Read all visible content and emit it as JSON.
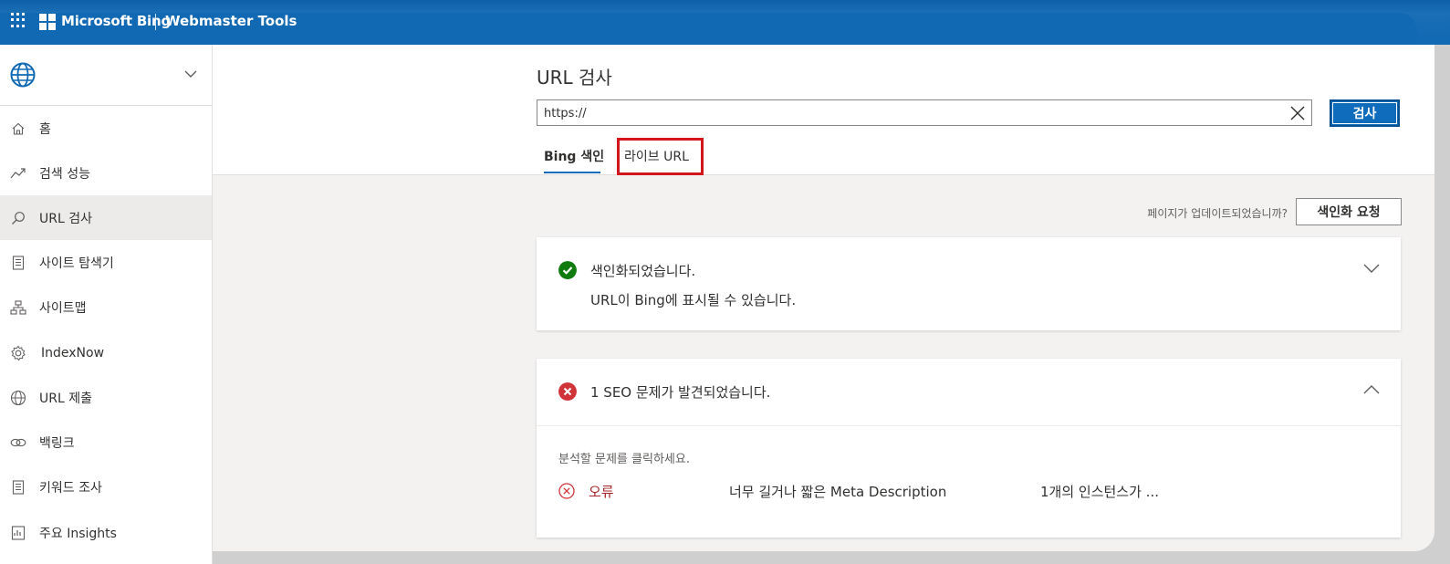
{
  "header": {
    "brand": "Microsoft Bing",
    "product": "Webmaster Tools"
  },
  "sidebar": {
    "items": [
      {
        "label": "홈",
        "icon": "home-icon"
      },
      {
        "label": "검색 성능",
        "icon": "trend-icon"
      },
      {
        "label": "URL 검사",
        "icon": "search-icon",
        "active": true
      },
      {
        "label": "사이트 탐색기",
        "icon": "document-icon"
      },
      {
        "label": "사이트맵",
        "icon": "sitemap-icon"
      },
      {
        "label": "IndexNow",
        "icon": "gear-icon"
      },
      {
        "label": "URL 제출",
        "icon": "globe-icon"
      },
      {
        "label": "백링크",
        "icon": "link-icon"
      },
      {
        "label": "키워드 조사",
        "icon": "document-icon"
      },
      {
        "label": "주요 Insights",
        "icon": "insights-icon"
      }
    ]
  },
  "main": {
    "title": "URL 검사",
    "search": {
      "value": "https://",
      "button": "검사"
    },
    "tabs": [
      {
        "label": "Bing 색인",
        "selected": true
      },
      {
        "label": "라이브 URL",
        "selected": false,
        "highlighted": true
      }
    ],
    "request": {
      "question": "페이지가 업데이트되었습니까?",
      "button": "색인화 요청"
    },
    "index_card": {
      "title": "색인화되었습니다.",
      "subtitle": "URL이 Bing에 표시될 수 있습니다."
    },
    "seo_card": {
      "title": "1 SEO 문제가 발견되었습니다.",
      "hint": "분석할 문제를 클릭하세요.",
      "issues": [
        {
          "type": "오류",
          "description": "너무 길거나 짧은 Meta Description",
          "count": "1개의 인스턴스가 ..."
        }
      ]
    }
  },
  "colors": {
    "accent": "#0f6cbd",
    "topbar": "#1169b3",
    "success": "#107c10",
    "error": "#d13438",
    "highlight": "#d4151c"
  }
}
